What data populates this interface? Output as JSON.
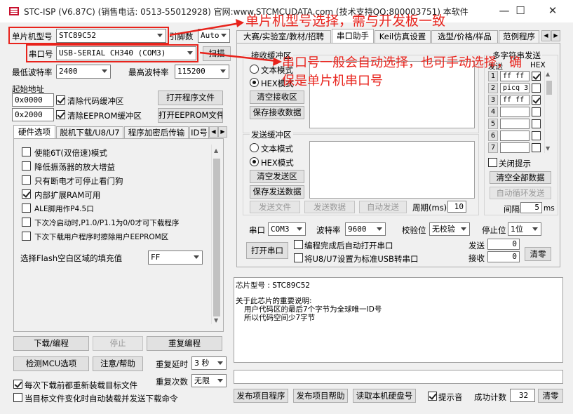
{
  "titlebar": {
    "title": "STC-ISP (V6.87C) (销售电话: 0513-55012928) 官网:www.STCMCUDATA.com  (技术支持QQ:800003751) 本软件",
    "min": "—",
    "max": "☐",
    "close": "✕"
  },
  "annotations": {
    "a1": "单片机型号选择，需与开发板一致",
    "a2_line1": "串口号一般会自动选择，也可手动选择，确",
    "a2_line2": "保是单片机串口号"
  },
  "left": {
    "mcu_label": "单片机型号",
    "mcu_value": "STC89C52",
    "pin_label": "引脚数",
    "pin_value": "Auto",
    "port_label": "串口号",
    "port_value": "USB-SERIAL CH340 (COM3)",
    "scan_button": "扫描",
    "min_baud_label": "最低波特率",
    "min_baud_value": "2400",
    "max_baud_label": "最高波特率",
    "max_baud_value": "115200",
    "start_addr_label": "起始地址",
    "addr1_value": "0x0000",
    "addr2_value": "0x2000",
    "clear_code_label": "清除代码缓冲区",
    "clear_eeprom_label": "清除EEPROM缓冲区",
    "open_program_button": "打开程序文件",
    "open_eeprom_button": "打开EEPROM文件",
    "tabs": [
      "硬件选项",
      "脱机下载/U8/U7",
      "程序加密后传输",
      "ID号"
    ],
    "options": [
      {
        "label": "使能6T(双倍速)模式",
        "checked": false
      },
      {
        "label": "降低振荡器的放大增益",
        "checked": false
      },
      {
        "label": "只有断电才可停止看门狗",
        "checked": false
      },
      {
        "label": "内部扩展RAM可用",
        "checked": true
      },
      {
        "label": "ALE脚用作P4.5口",
        "checked": false
      },
      {
        "label": "下次冷启动时,P1.0/P1.1为0/0才可下载程序",
        "checked": false
      },
      {
        "label": "下次下载用户程序时擦除用户EEPROM区",
        "checked": false
      }
    ],
    "fill_label": "选择Flash空白区域的填充值",
    "fill_value": "FF",
    "download_button": "下载/编程",
    "stop_button": "停止",
    "reprogram_button": "重复编程",
    "check_mcu_button": "检测MCU选项",
    "help_button": "注意/帮助",
    "retry_delay_label": "重复延时",
    "retry_delay_value": "3 秒",
    "retry_count_label": "重复次数",
    "retry_count_value": "无限",
    "reload_label": "每次下载前都重新装载目标文件",
    "auto_load_label": "当目标文件变化时自动装载并发送下载命令"
  },
  "right": {
    "tabs": [
      "大赛/实验室/教材/招聘",
      "串口助手",
      "Keil仿真设置",
      "选型/价格/样品",
      "范例程序"
    ],
    "recv_group": "接收缓冲区",
    "text_mode": "文本模式",
    "hex_mode": "HEX模式",
    "clear_recv": "清空接收区",
    "save_recv": "保存接收数据",
    "send_group": "发送缓冲区",
    "clear_send": "清空发送区",
    "save_send": "保存发送数据",
    "send_file": "发送文件",
    "send_data": "发送数据",
    "auto_send": "自动发送",
    "period_label": "周期(ms)",
    "period_value": "10",
    "multi_title": "多字符串发送",
    "multi_send_col": "发送",
    "multi_hex_col": "HEX",
    "multi_rows": [
      {
        "n": "1",
        "v": "ff ff",
        "hex": true
      },
      {
        "n": "2",
        "v": "picq 3",
        "hex": false
      },
      {
        "n": "3",
        "v": "ff ff",
        "hex": true
      },
      {
        "n": "4",
        "v": "",
        "hex": false
      },
      {
        "n": "5",
        "v": "",
        "hex": false
      },
      {
        "n": "6",
        "v": "",
        "hex": false
      },
      {
        "n": "7",
        "v": "",
        "hex": false
      }
    ],
    "close_tip": "关闭提示",
    "clear_all": "清空全部数据",
    "auto_loop": "自动循环发送",
    "interval_label": "间隔",
    "interval_value": "5",
    "interval_unit": "ms",
    "port_label": "串口",
    "port_value": "COM3",
    "baud_label": "波特率",
    "baud_value": "9600",
    "parity_label": "校验位",
    "parity_value": "无校验",
    "stop_label": "停止位",
    "stop_value": "1位",
    "open_port": "打开串口",
    "auto_open_label": "编程完成后自动打开串口",
    "usb_label": "将U8/U7设置为标准USB转串口",
    "send_count_label": "发送",
    "send_count_value": "0",
    "recv_count_label": "接收",
    "recv_count_value": "0",
    "clear_count": "清零"
  },
  "info": {
    "line1": "芯片型号 : STC89C52",
    "line2": "关于此芯片的重要说明:",
    "line3": "用户代码区的最后7个字节为全球唯一ID号",
    "line4": "所以代码空间少7字节"
  },
  "bottom": {
    "publish_program": "发布项目程序",
    "publish_help": "发布项目帮助",
    "read_disk": "读取本机硬盘号",
    "sound_label": "提示音",
    "success_label": "成功计数",
    "success_value": "32",
    "clear": "清零"
  },
  "colors": {
    "accent_red": "#e8231c",
    "window_bg": "#f0f0f0"
  }
}
